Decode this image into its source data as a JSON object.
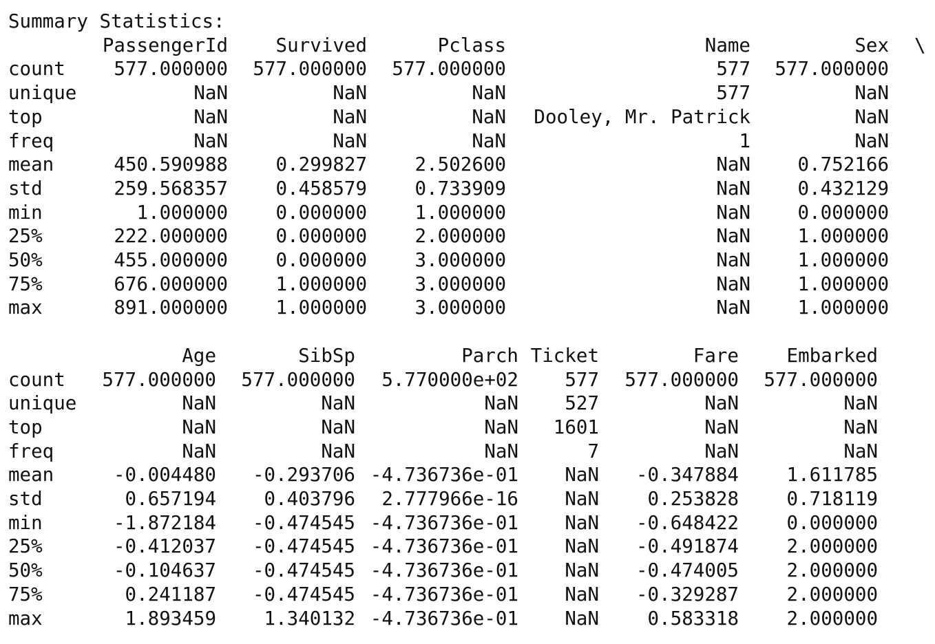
{
  "title": "Summary Statistics:",
  "continuation_marker": "\\",
  "row_labels": [
    "count",
    "unique",
    "top",
    "freq",
    "mean",
    "std",
    "min",
    "25%",
    "50%",
    "75%",
    "max"
  ],
  "tables": [
    {
      "columns": [
        "PassengerId",
        "Survived",
        "Pclass",
        "Name",
        "Sex"
      ],
      "rows": [
        [
          "577.000000",
          "577.000000",
          "577.000000",
          "577",
          "577.000000"
        ],
        [
          "NaN",
          "NaN",
          "NaN",
          "577",
          "NaN"
        ],
        [
          "NaN",
          "NaN",
          "NaN",
          "Dooley, Mr. Patrick",
          "NaN"
        ],
        [
          "NaN",
          "NaN",
          "NaN",
          "1",
          "NaN"
        ],
        [
          "450.590988",
          "0.299827",
          "2.502600",
          "NaN",
          "0.752166"
        ],
        [
          "259.568357",
          "0.458579",
          "0.733909",
          "NaN",
          "0.432129"
        ],
        [
          "1.000000",
          "0.000000",
          "1.000000",
          "NaN",
          "0.000000"
        ],
        [
          "222.000000",
          "0.000000",
          "2.000000",
          "NaN",
          "1.000000"
        ],
        [
          "455.000000",
          "0.000000",
          "3.000000",
          "NaN",
          "1.000000"
        ],
        [
          "676.000000",
          "1.000000",
          "3.000000",
          "NaN",
          "1.000000"
        ],
        [
          "891.000000",
          "1.000000",
          "3.000000",
          "NaN",
          "1.000000"
        ]
      ]
    },
    {
      "columns": [
        "Age",
        "SibSp",
        "Parch",
        "Ticket",
        "Fare",
        "Embarked"
      ],
      "rows": [
        [
          "577.000000",
          "577.000000",
          "5.770000e+02",
          "577",
          "577.000000",
          "577.000000"
        ],
        [
          "NaN",
          "NaN",
          "NaN",
          "527",
          "NaN",
          "NaN"
        ],
        [
          "NaN",
          "NaN",
          "NaN",
          "1601",
          "NaN",
          "NaN"
        ],
        [
          "NaN",
          "NaN",
          "NaN",
          "7",
          "NaN",
          "NaN"
        ],
        [
          "-0.004480",
          "-0.293706",
          "-4.736736e-01",
          "NaN",
          "-0.347884",
          "1.611785"
        ],
        [
          "0.657194",
          "0.403796",
          "2.777966e-16",
          "NaN",
          "0.253828",
          "0.718119"
        ],
        [
          "-1.872184",
          "-0.474545",
          "-4.736736e-01",
          "NaN",
          "-0.648422",
          "0.000000"
        ],
        [
          "-0.412037",
          "-0.474545",
          "-4.736736e-01",
          "NaN",
          "-0.491874",
          "2.000000"
        ],
        [
          "-0.104637",
          "-0.474545",
          "-4.736736e-01",
          "NaN",
          "-0.474005",
          "2.000000"
        ],
        [
          "0.241187",
          "-0.474545",
          "-4.736736e-01",
          "NaN",
          "-0.329287",
          "2.000000"
        ],
        [
          "1.893459",
          "1.340132",
          "-4.736736e-01",
          "NaN",
          "0.583318",
          "2.000000"
        ]
      ]
    }
  ]
}
